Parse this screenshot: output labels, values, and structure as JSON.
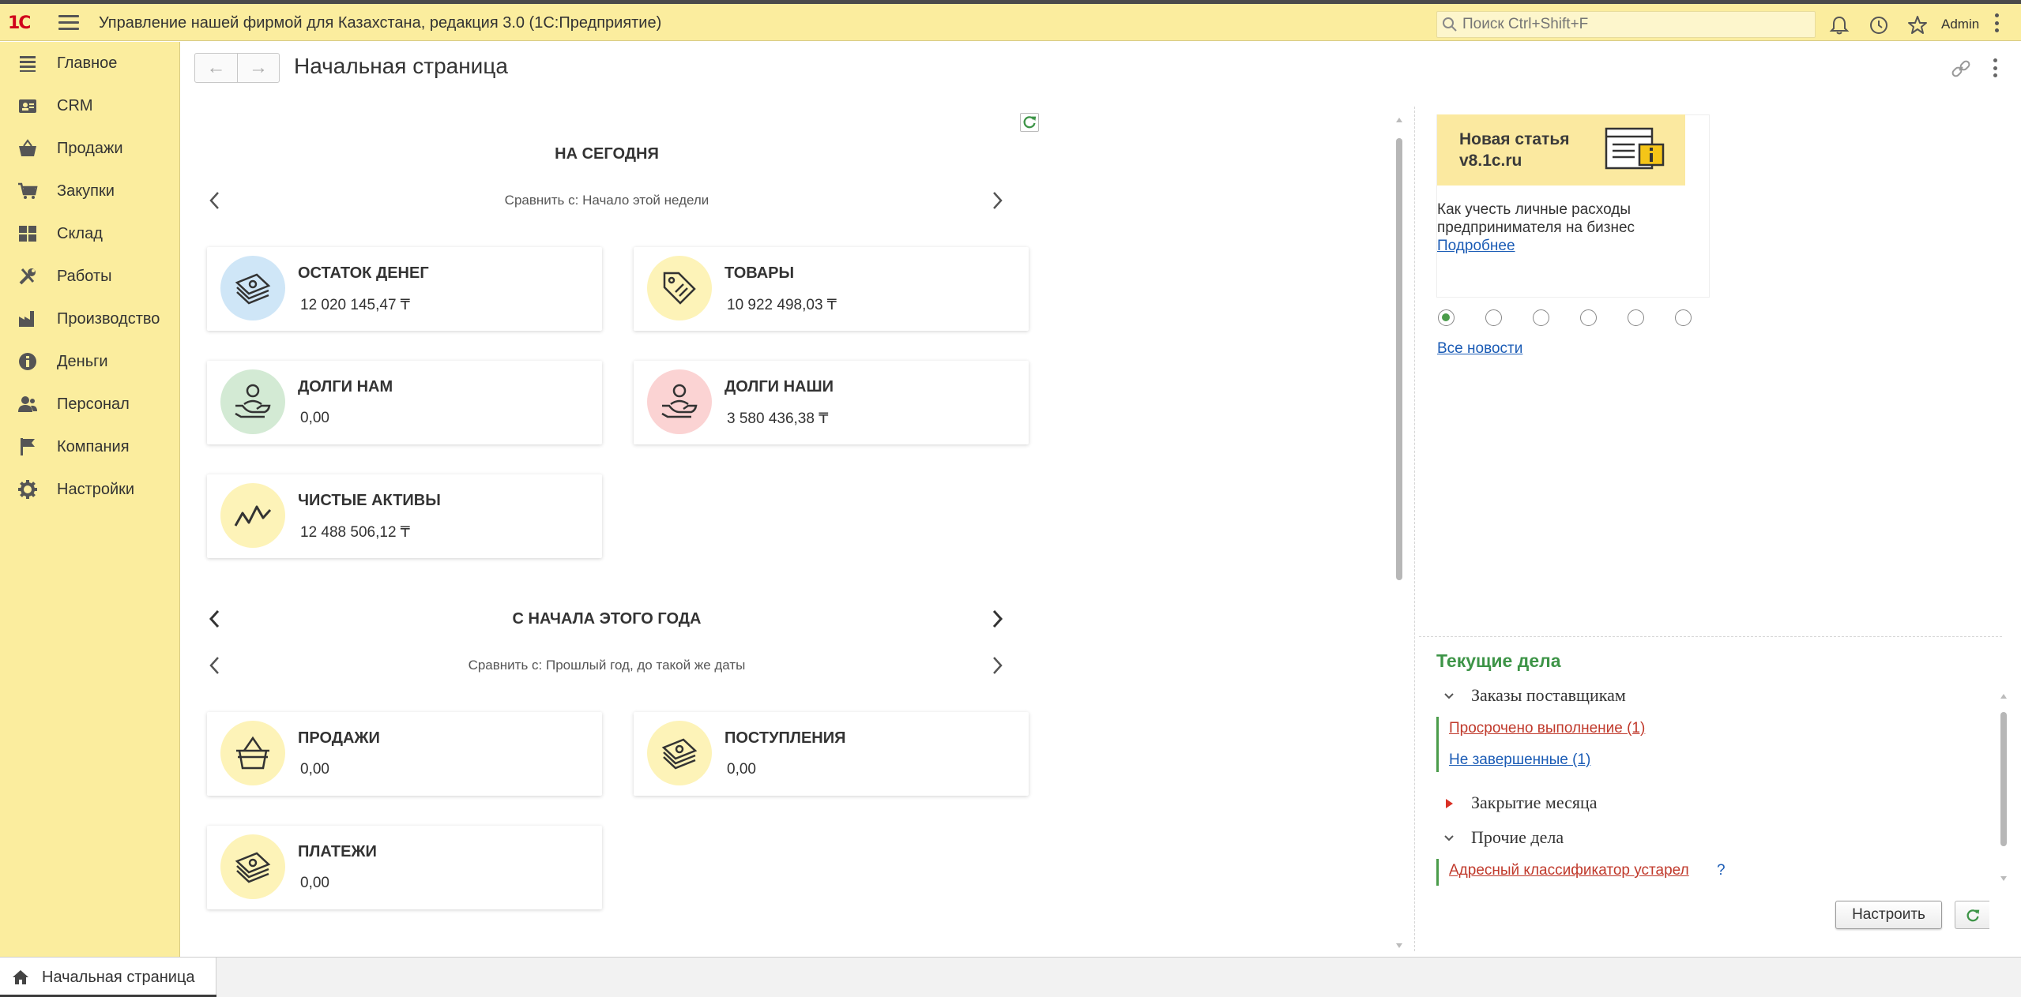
{
  "app": {
    "title": "Управление нашей фирмой для Казахстана, редакция 3.0  (1С:Предприятие)",
    "logo_text": "1С",
    "search_placeholder": "Поиск Ctrl+Shift+F",
    "user": "Admin"
  },
  "sidebar": {
    "items": [
      {
        "label": "Главное",
        "icon": "menu-lines-icon"
      },
      {
        "label": "CRM",
        "icon": "contacts-icon"
      },
      {
        "label": "Продажи",
        "icon": "basket-icon"
      },
      {
        "label": "Закупки",
        "icon": "cart-icon"
      },
      {
        "label": "Склад",
        "icon": "warehouse-grid-icon"
      },
      {
        "label": "Работы",
        "icon": "tools-icon"
      },
      {
        "label": "Производство",
        "icon": "factory-icon"
      },
      {
        "label": "Деньги",
        "icon": "money-icon"
      },
      {
        "label": "Персонал",
        "icon": "people-icon"
      },
      {
        "label": "Компания",
        "icon": "flag-icon"
      },
      {
        "label": "Настройки",
        "icon": "gear-icon"
      }
    ]
  },
  "page": {
    "title": "Начальная страница"
  },
  "today": {
    "title": "НА СЕГОДНЯ",
    "compare": "Сравнить с: Начало этой недели",
    "cards": [
      {
        "title": "ОСТАТОК ДЕНЕГ",
        "value": "12 020 145,47 ₸",
        "color": "#cfe6f7",
        "icon": "money-stack-icon"
      },
      {
        "title": "ТОВАРЫ",
        "value": "10 922 498,03 ₸",
        "color": "#fdf3b8",
        "icon": "price-tag-icon"
      },
      {
        "title": "ДОЛГИ НАМ",
        "value": "0,00",
        "color": "#d3ead4",
        "icon": "hand-person-icon"
      },
      {
        "title": "ДОЛГИ НАШИ",
        "value": "3 580 436,38 ₸",
        "color": "#fbd3d3",
        "icon": "hand-person-icon"
      },
      {
        "title": "ЧИСТЫЕ АКТИВЫ",
        "value": "12 488 506,12 ₸",
        "color": "#fdf3b8",
        "icon": "trend-line-icon"
      }
    ]
  },
  "year": {
    "title": "С НАЧАЛА ЭТОГО ГОДА",
    "compare": "Сравнить с: Прошлый год, до такой же даты",
    "cards": [
      {
        "title": "ПРОДАЖИ",
        "value": "0,00",
        "color": "#fdf3b8",
        "icon": "basket-icon"
      },
      {
        "title": "ПОСТУПЛЕНИЯ",
        "value": "0,00",
        "color": "#fdf3b8",
        "icon": "money-stack-icon"
      },
      {
        "title": "ПЛАТЕЖИ",
        "value": "0,00",
        "color": "#fdf3b8",
        "icon": "money-stack-icon"
      }
    ]
  },
  "news": {
    "banner": "Новая статья v8.1c.ru",
    "text": "Как учесть личные расходы предпринимателя на бизнес",
    "more": "Подробнее",
    "all": "Все новости",
    "selected_index": 0,
    "count": 6
  },
  "tasks": {
    "title": "Текущие дела",
    "groups": [
      {
        "label": "Заказы поставщикам",
        "state": "expanded"
      },
      {
        "label": "Закрытие месяца",
        "state": "collapsed"
      },
      {
        "label": "Прочие дела",
        "state": "expanded"
      }
    ],
    "links": [
      {
        "label": "Просрочено выполнение (1)",
        "color": "#c0392b"
      },
      {
        "label": "Не завершенные (1)",
        "color": "#1a5bb5"
      },
      {
        "label": "Адресный классификатор устарел",
        "color": "#c0392b"
      }
    ],
    "help": "?",
    "setup_button": "Настроить"
  },
  "bottom": {
    "tab": "Начальная страница"
  }
}
